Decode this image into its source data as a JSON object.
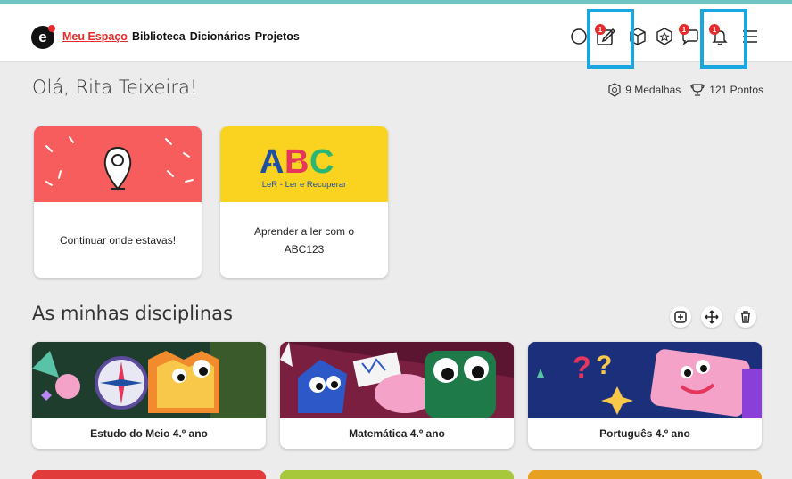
{
  "nav": {
    "items": [
      "Meu Espaço",
      "Biblioteca",
      "Dicionários",
      "Projetos"
    ]
  },
  "header": {
    "logo": "e",
    "badges": [
      "1",
      "1",
      "1"
    ]
  },
  "greeting": "Olá, Rita Teixeira!",
  "stats": {
    "medals": "9 Medalhas",
    "points": "121 Pontos"
  },
  "cards": [
    {
      "label": "Continuar onde estavas!"
    },
    {
      "label": "Aprender a ler com o ABC123",
      "brand": "LeR - Ler e Recuperar",
      "letters": [
        "A",
        "B",
        "C"
      ],
      "digits": [
        "1",
        "2",
        "3"
      ]
    }
  ],
  "section_title": "As minhas disciplinas",
  "disciplines": [
    {
      "label": "Estudo do Meio 4.º ano"
    },
    {
      "label": "Matemática 4.º ano"
    },
    {
      "label": "Português 4.º ano"
    }
  ],
  "colors": {
    "accent": "#e52b2b",
    "highlight": "#1aa6e0",
    "card1": "#f75d5d",
    "card2": "#f9d31f"
  }
}
